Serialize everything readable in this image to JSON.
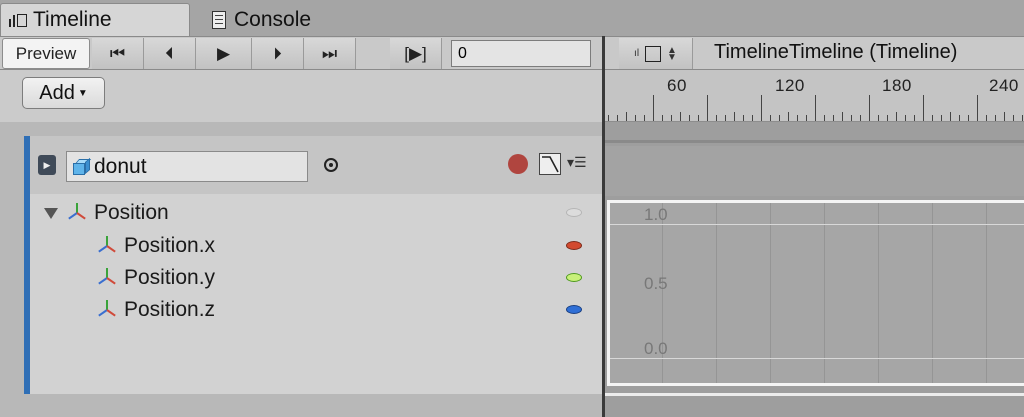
{
  "tabs": [
    {
      "label": "Timeline",
      "icon": "timeline-bars-icon",
      "active": true
    },
    {
      "label": "Console",
      "icon": "console-document-icon",
      "active": false
    }
  ],
  "toolbar": {
    "preview_label": "Preview",
    "first_key_glyph": "⏮",
    "prev_frame_glyph": "⏴",
    "play_glyph": "▶",
    "next_frame_glyph": "⏵",
    "last_key_glyph": "⏭",
    "play_range_glyph": "[▶]",
    "frame_value": "0",
    "timeline_title": "TimelineTimeline (Timeline)"
  },
  "left_header": {
    "add_label": "Add"
  },
  "ruler": {
    "labels": [
      "60",
      "120",
      "180",
      "240"
    ]
  },
  "track": {
    "object_name": "donut",
    "accent_color": "#2f6fb6",
    "record_color": "#b0453f",
    "properties": [
      {
        "label": "Position",
        "dot_color": "#c0c0c0",
        "expanded": true
      },
      {
        "label": "Position.x",
        "dot_color": "#d24a2f"
      },
      {
        "label": "Position.y",
        "dot_color": "#7fd43c"
      },
      {
        "label": "Position.z",
        "dot_color": "#2f6fd6"
      }
    ]
  },
  "curves": {
    "y_labels": [
      "1.0",
      "0.5",
      "0.0"
    ]
  }
}
